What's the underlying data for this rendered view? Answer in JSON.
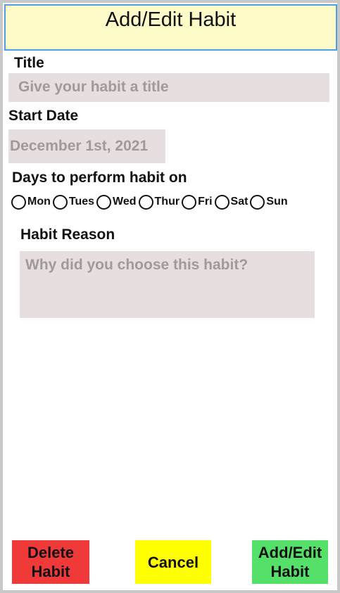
{
  "header": {
    "title": "Add/Edit Habit"
  },
  "title_section": {
    "label": "Title",
    "placeholder": "Give your habit a title"
  },
  "start_date": {
    "label": "Start Date",
    "value": "December 1st, 2021"
  },
  "days": {
    "label": "Days to perform habit on",
    "items": [
      "Mon",
      "Tues",
      "Wed",
      "Thur",
      "Fri",
      "Sat",
      "Sun"
    ]
  },
  "reason": {
    "label": "Habit Reason",
    "placeholder": "Why did you choose this habit?"
  },
  "buttons": {
    "delete": "Delete\nHabit",
    "cancel": "Cancel",
    "add_edit": "Add/Edit\nHabit"
  },
  "colors": {
    "header_bg": "#fdfbc8",
    "header_border": "#4aa0e0",
    "field_bg": "#e6dedf",
    "delete_bg": "#f03a3a",
    "cancel_bg": "#ffff00",
    "add_bg": "#55e06a"
  }
}
